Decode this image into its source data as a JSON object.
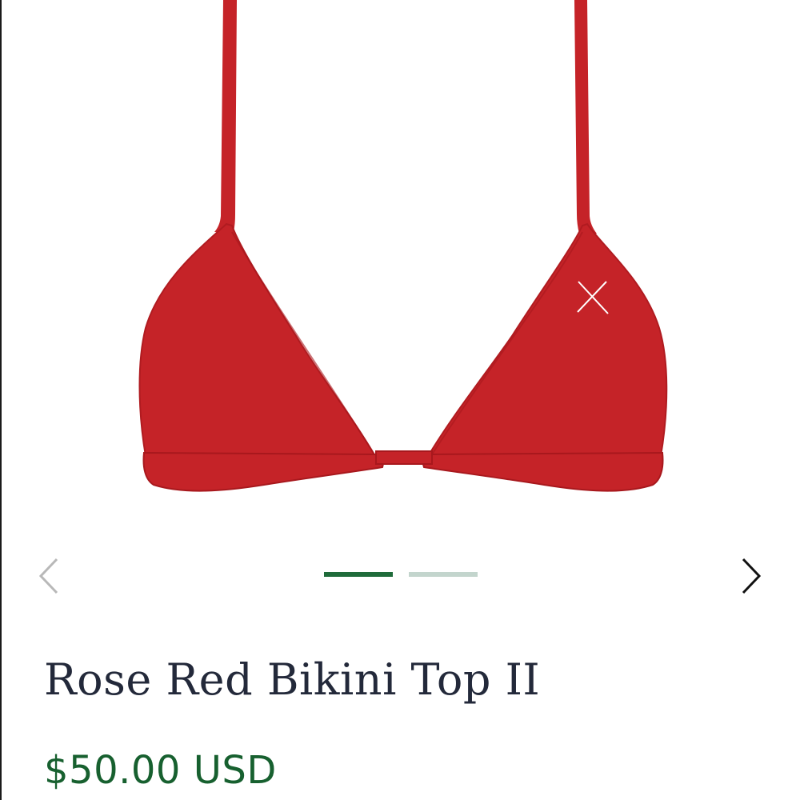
{
  "product": {
    "title": "Rose Red Bikini Top II",
    "price": "$50.00 USD",
    "image": {
      "subject": "red triangle bikini top",
      "color": "#c52328",
      "logo_mark": "x-logo-icon"
    }
  },
  "carousel": {
    "prev_icon": "chevron-left-icon",
    "next_icon": "chevron-right-icon",
    "active_index": 0,
    "slide_count": 2,
    "active_color": "#1f6b3a",
    "inactive_color": "#c3d5cd"
  },
  "colors": {
    "title": "#23293a",
    "price": "#17602f",
    "background": "#ffffff"
  }
}
